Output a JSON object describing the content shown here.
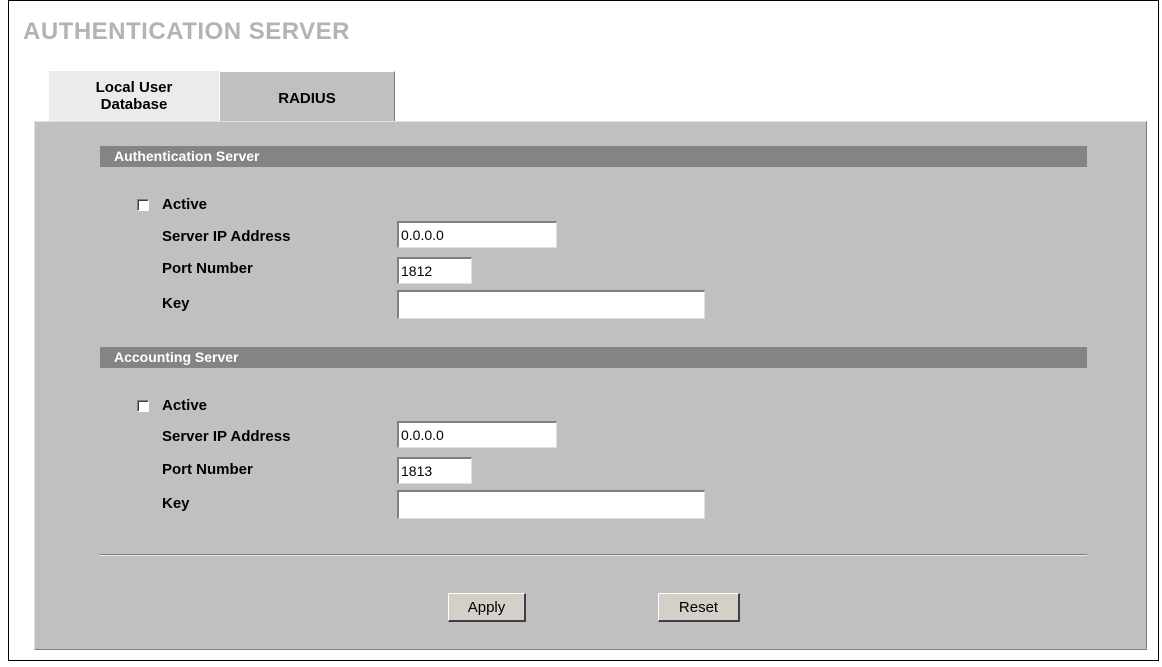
{
  "page_title": "AUTHENTICATION SERVER",
  "tabs": [
    {
      "label": "Local User\nDatabase"
    },
    {
      "label": "RADIUS"
    }
  ],
  "authentication_server": {
    "header": "Authentication Server",
    "active_label": "Active",
    "active_checked": false,
    "server_ip_label": "Server IP Address",
    "server_ip_value": "0.0.0.0",
    "port_label": "Port Number",
    "port_value": "1812",
    "key_label": "Key",
    "key_value": ""
  },
  "accounting_server": {
    "header": "Accounting Server",
    "active_label": "Active",
    "active_checked": false,
    "server_ip_label": "Server IP Address",
    "server_ip_value": "0.0.0.0",
    "port_label": "Port Number",
    "port_value": "1813",
    "key_label": "Key",
    "key_value": ""
  },
  "buttons": {
    "apply": "Apply",
    "reset": "Reset"
  }
}
